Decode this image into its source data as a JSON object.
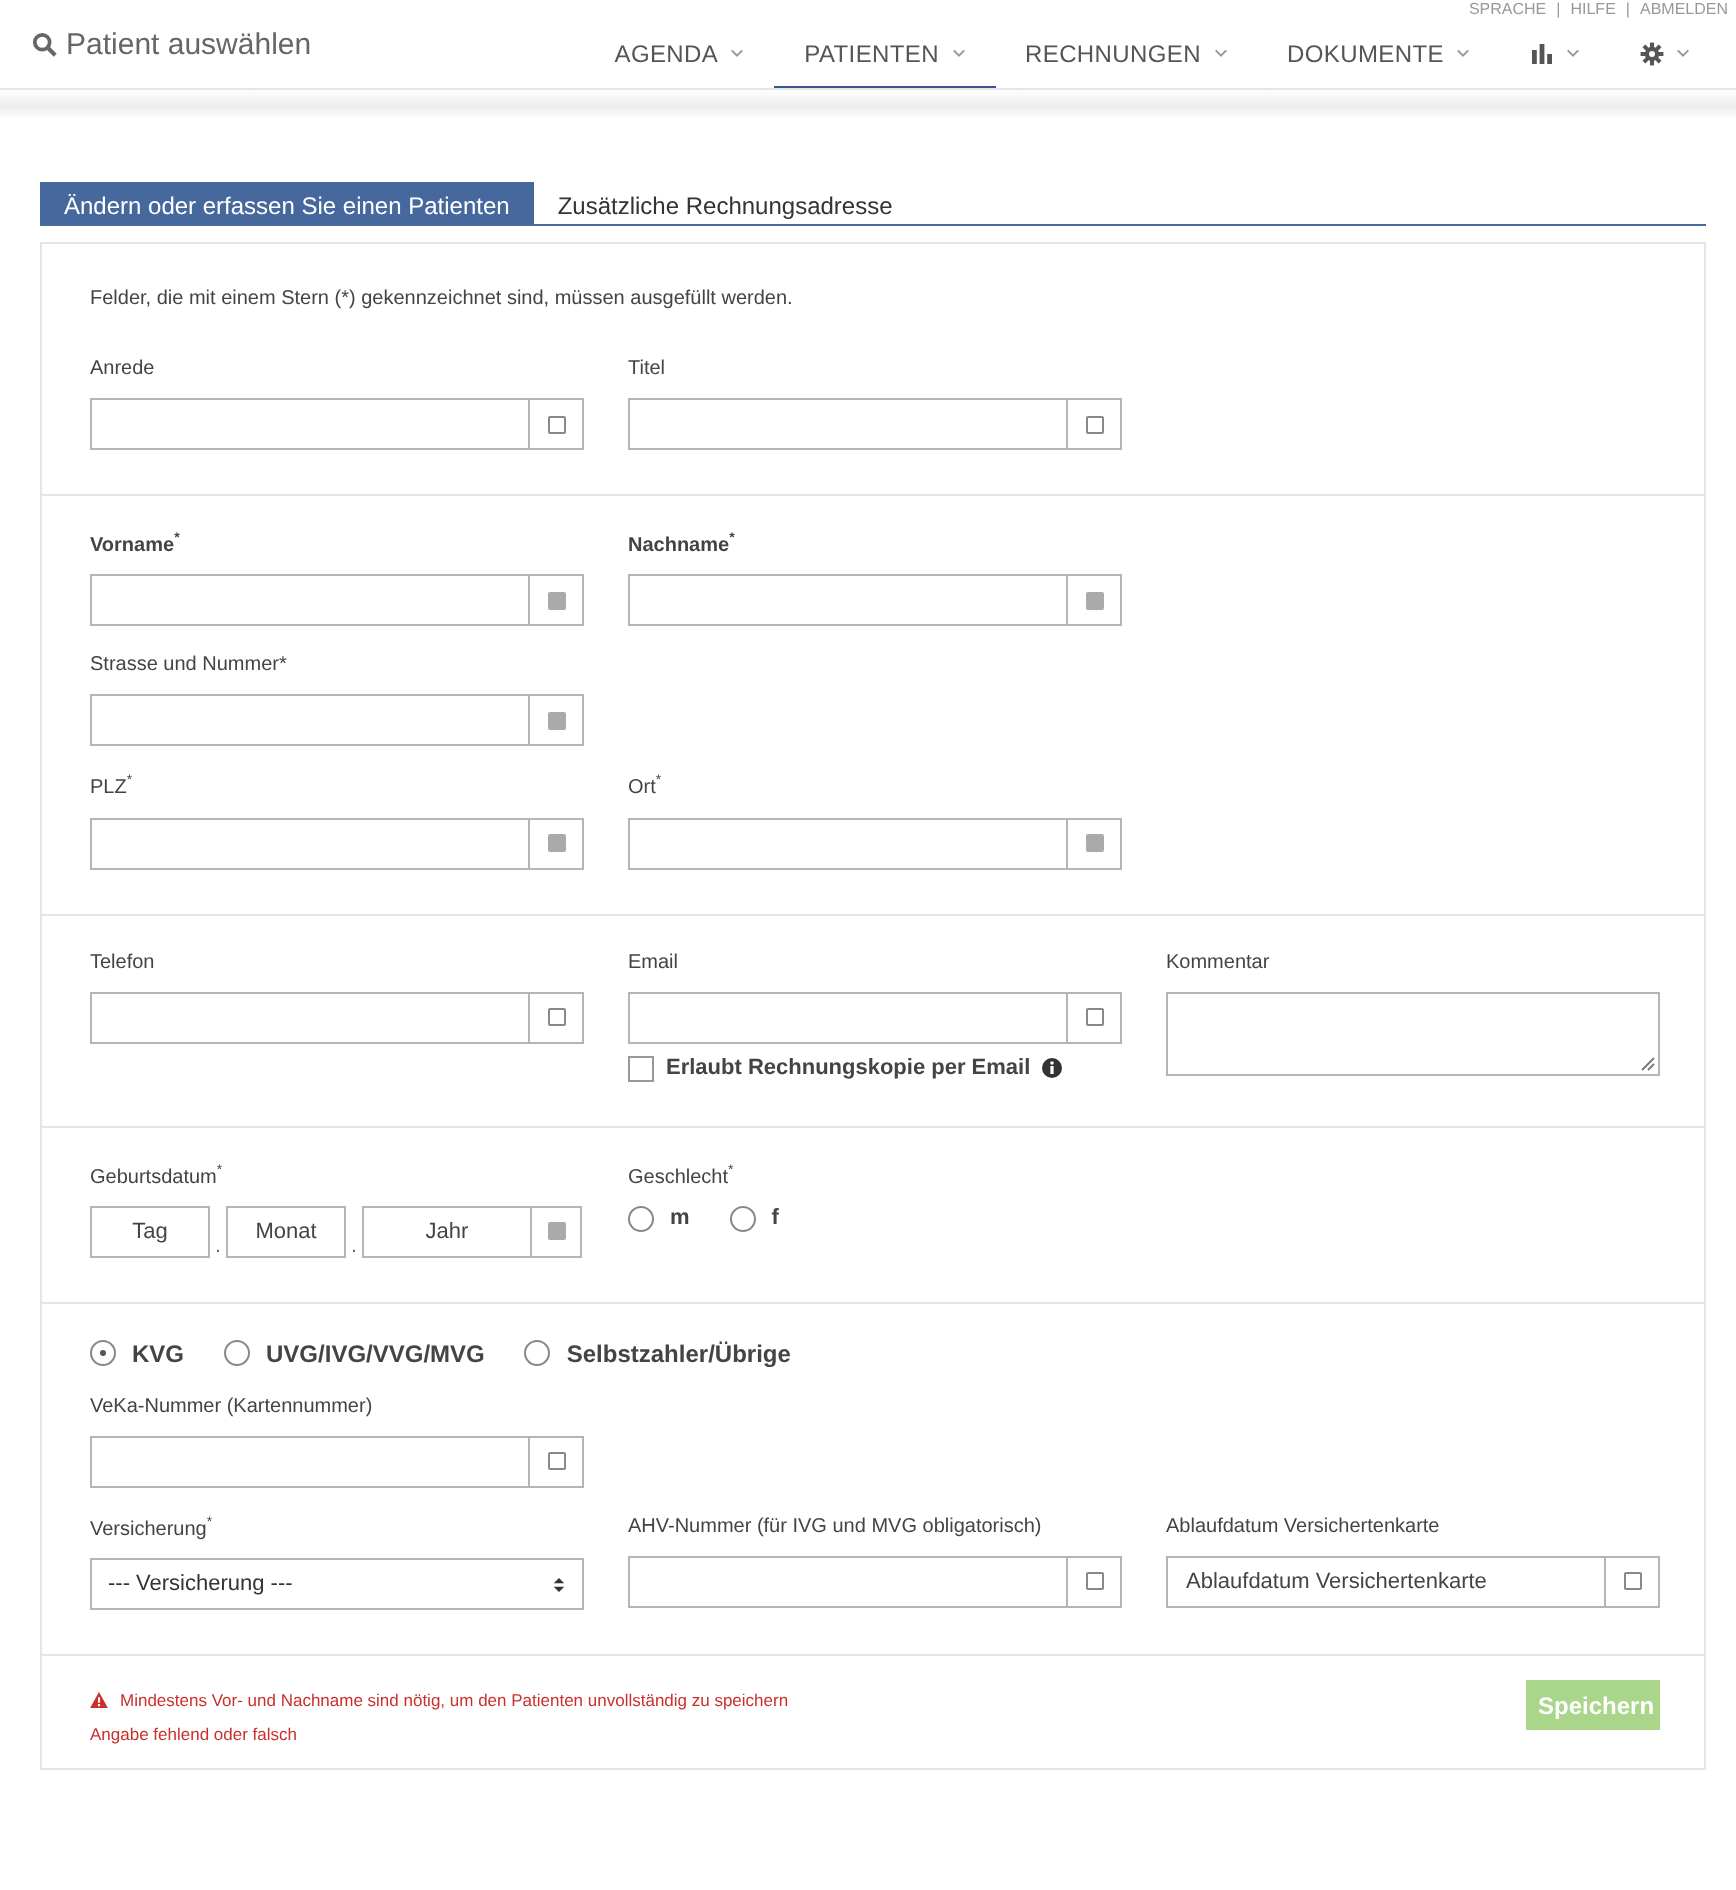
{
  "header": {
    "search_label": "Patient auswählen",
    "top_links": [
      "SPRACHE",
      "HILFE",
      "ABMELDEN"
    ],
    "link_separator": "|",
    "nav": [
      {
        "kind": "text",
        "label": "AGENDA",
        "selected": false
      },
      {
        "kind": "text",
        "label": "PATIENTEN",
        "selected": true
      },
      {
        "kind": "text",
        "label": "RECHNUNGEN",
        "selected": false
      },
      {
        "kind": "text",
        "label": "DOKUMENTE",
        "selected": false
      },
      {
        "kind": "chart",
        "selected": false
      },
      {
        "kind": "gear",
        "selected": false
      }
    ]
  },
  "tabs": [
    {
      "label": "Ändern oder erfassen Sie einen Patienten",
      "selected": true
    },
    {
      "label": "Zusätzliche Rechnungsadresse",
      "selected": false
    }
  ],
  "form": {
    "note": "Felder, die mit einem Stern (*) gekennzeichnet sind, müssen ausgefüllt werden.",
    "sections": [
      {
        "rows": [
          [
            {
              "kind": "input",
              "label": "Anrede",
              "bold": false,
              "required": false
            },
            {
              "kind": "input",
              "label": "Titel",
              "bold": false,
              "required": false
            }
          ]
        ]
      },
      {
        "rows": [
          [
            {
              "kind": "input",
              "label": "Vorname$^{*}$",
              "bold": true,
              "required": true
            },
            {
              "kind": "input",
              "label": "Nachname$^{*}$",
              "bold": true,
              "required": true
            }
          ],
          [
            {
              "kind": "input",
              "label": "Strasse und Nummer*",
              "bold": false,
              "required": true
            }
          ],
          [
            {
              "kind": "input",
              "label": "PLZ$^{*}$",
              "bold": false,
              "required": true
            },
            {
              "kind": "input",
              "label": "Ort$^{*}$",
              "bold": false,
              "required": true
            }
          ]
        ]
      },
      {
        "rows": [
          [
            {
              "kind": "input",
              "label": "Telefon",
              "bold": false,
              "required": false
            },
            {
              "kind": "input",
              "label": "Email",
              "bold": false,
              "required": false,
              "checkbox": {
                "label": "Erlaubt Rechnungskopie per Email",
                "checked": false
              }
            },
            {
              "kind": "textarea",
              "label": "Kommentar"
            }
          ]
        ]
      },
      {
        "rows": [
          [
            {
              "kind": "date",
              "label": "Geburtsdatum$^{*}$",
              "required": true,
              "placeholders": [
                "Tag",
                "Monat",
                "Jahr"
              ],
              "separator": "."
            },
            {
              "kind": "radios",
              "label": "Geschlecht$^{*}$",
              "options": [
                {
                  "label": "m",
                  "selected": false
                },
                {
                  "label": "f",
                  "selected": false
                }
              ]
            }
          ]
        ]
      },
      {
        "rows": [
          [
            {
              "kind": "radios",
              "options": [
                {
                  "label": "KVG",
                  "selected": true
                },
                {
                  "label": "UVG/IVG/VVG/MVG",
                  "selected": false
                },
                {
                  "label": "Selbstzahler/Übrige",
                  "selected": false
                }
              ]
            }
          ],
          [
            {
              "kind": "input",
              "label": "VeKa-Nummer (Kartennummer)",
              "bold": false,
              "required": false
            }
          ],
          [
            {
              "kind": "select",
              "label": "Versicherung$^{*}$",
              "value": "--- Versicherung ---"
            },
            {
              "kind": "input",
              "label": "AHV-Nummer (für IVG und MVG obligatorisch)",
              "bold": false,
              "required": false
            },
            {
              "kind": "input",
              "label": "Ablaufdatum Versichertenkarte",
              "bold": false,
              "required": false,
              "placeholder": "Ablaufdatum Versichertenkarte"
            }
          ]
        ]
      }
    ]
  },
  "footer": {
    "warning": "Mindestens Vor- und Nachname sind nötig, um den Patienten unvollständig zu speichern",
    "error": "Angabe fehlend oder falsch",
    "save_button": {
      "label": "Speichern",
      "disabled": true
    }
  }
}
